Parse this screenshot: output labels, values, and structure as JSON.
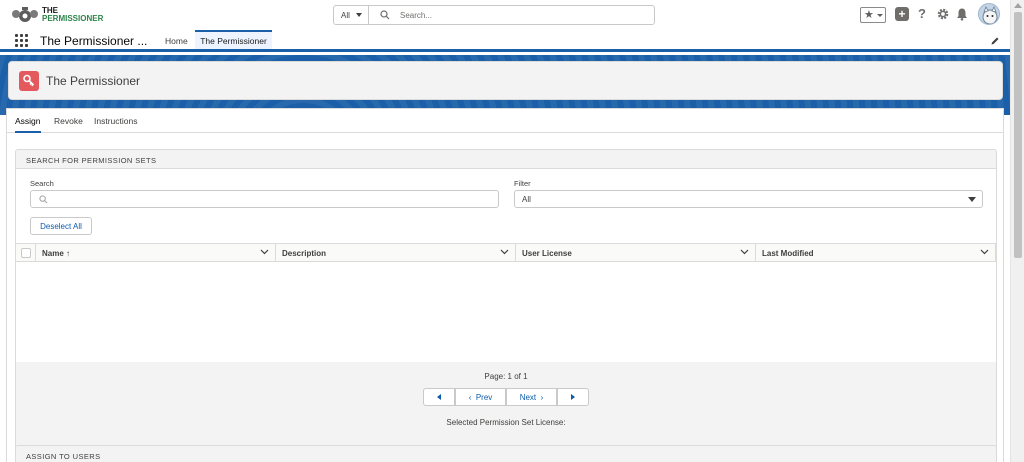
{
  "header": {
    "logo": {
      "line1": "THE",
      "line2": "PERMISSIONER"
    },
    "search": {
      "scope": "All",
      "placeholder": "Search..."
    },
    "icons": [
      "favorites-star-icon",
      "add-icon",
      "help-icon",
      "setup-gear-icon",
      "notification-bell-icon",
      "user-avatar"
    ]
  },
  "nav": {
    "app_name": "The Permissioner ...",
    "tabs": [
      {
        "label": "Home",
        "active": false
      },
      {
        "label": "The Permissioner",
        "active": true
      }
    ]
  },
  "page_header": {
    "title": "The Permissioner"
  },
  "tabs": [
    {
      "label": "Assign",
      "active": true
    },
    {
      "label": "Revoke",
      "active": false
    },
    {
      "label": "Instructions",
      "active": false
    }
  ],
  "search_section": {
    "title": "SEARCH FOR PERMISSION SETS",
    "search_label": "Search",
    "search_value": "",
    "filter_label": "Filter",
    "filter_value": "All",
    "deselect_label": "Deselect All",
    "columns": [
      {
        "label": "Name",
        "sort": "↑"
      },
      {
        "label": "Description"
      },
      {
        "label": "User License"
      },
      {
        "label": "Last Modified"
      }
    ],
    "rows": [],
    "pagination": {
      "page_info": "Page: 1 of 1",
      "prev_label": "Prev",
      "next_label": "Next"
    },
    "selected_license_label": "Selected Permission Set License:"
  },
  "assign_section": {
    "title": "ASSIGN TO USERS"
  },
  "colors": {
    "brand_blue": "#1b5fa8",
    "link_blue": "#0b5cab",
    "page_icon": "#e3595e",
    "logo_green": "#2e844a"
  }
}
